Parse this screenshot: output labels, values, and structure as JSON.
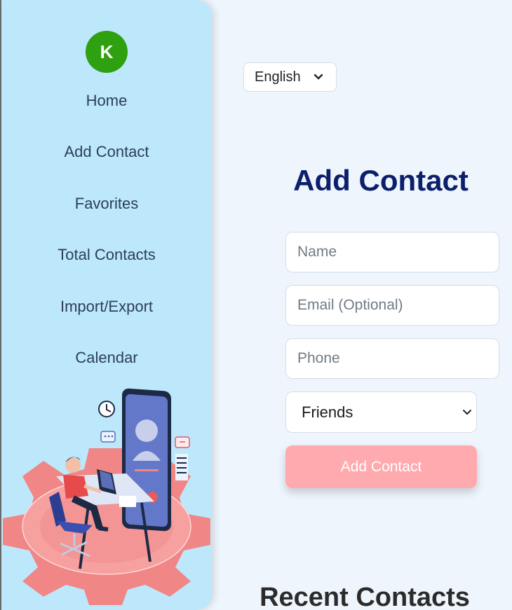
{
  "user": {
    "avatar_initial": "K"
  },
  "sidebar": {
    "items": [
      {
        "label": "Home"
      },
      {
        "label": "Add Contact"
      },
      {
        "label": "Favorites"
      },
      {
        "label": "Total Contacts"
      },
      {
        "label": "Import/Export"
      },
      {
        "label": "Calendar"
      }
    ]
  },
  "language": {
    "selected": "English"
  },
  "form": {
    "title": "Add Contact",
    "name_placeholder": "Name",
    "email_placeholder": "Email (Optional)",
    "phone_placeholder": "Phone",
    "group_selected": "Friends",
    "submit_label": "Add Contact"
  },
  "recent": {
    "title": "Recent Contacts"
  },
  "colors": {
    "sidebar_bg": "#bde8fc",
    "avatar_bg": "#2fa010",
    "title_color": "#0b1f6b",
    "button_bg": "#ffaaae",
    "page_bg": "#eef5fd"
  }
}
